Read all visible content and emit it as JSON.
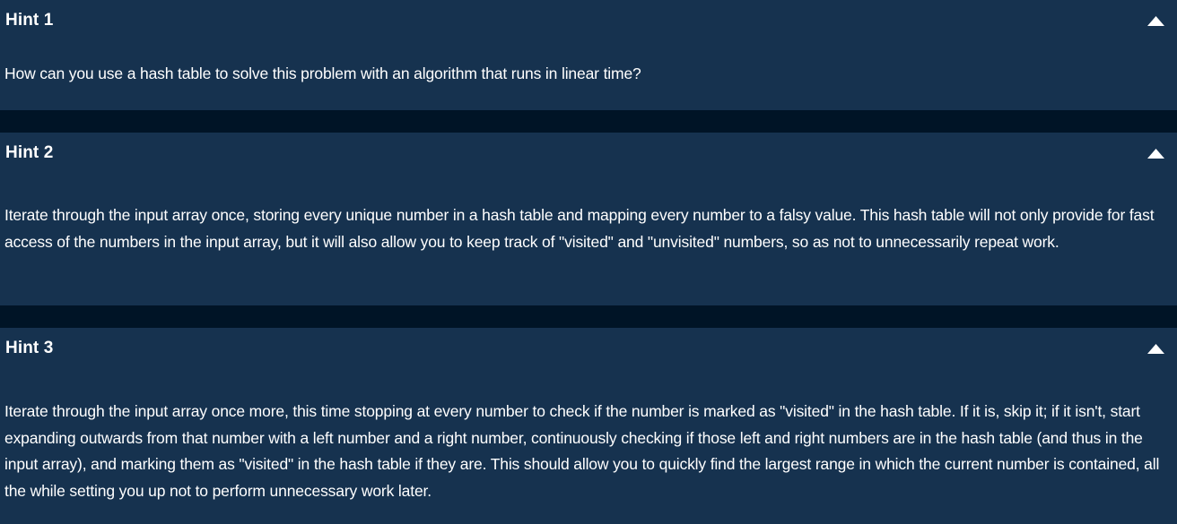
{
  "hints": [
    {
      "title": "Hint 1",
      "body": "How can you use a hash table to solve this problem with an algorithm that runs in linear time?",
      "toggle_icon": "chevron-up-icon"
    },
    {
      "title": "Hint 2",
      "body": "Iterate through the input array once, storing every unique number in a hash table and mapping every number to a falsy value. This hash table will not only provide for fast access of the numbers in the input array, but it will also allow you to keep track of \"visited\" and \"unvisited\" numbers, so as not to unnecessarily repeat work.",
      "toggle_icon": "chevron-up-icon"
    },
    {
      "title": "Hint 3",
      "body": "Iterate through the input array once more, this time stopping at every number to check if the number is marked as \"visited\" in the hash table. If it is, skip it; if it isn't, start expanding outwards from that number with a left number and a right number, continuously checking if those left and right numbers are in the hash table (and thus in the input array), and marking them as \"visited\" in the hash table if they are. This should allow you to quickly find the largest range in which the current number is contained, all the while setting you up not to perform unnecessary work later.",
      "toggle_icon": "chevron-up-icon"
    }
  ],
  "colors": {
    "panel": "#16324f",
    "gap": "#001426",
    "text": "#ffffff"
  }
}
